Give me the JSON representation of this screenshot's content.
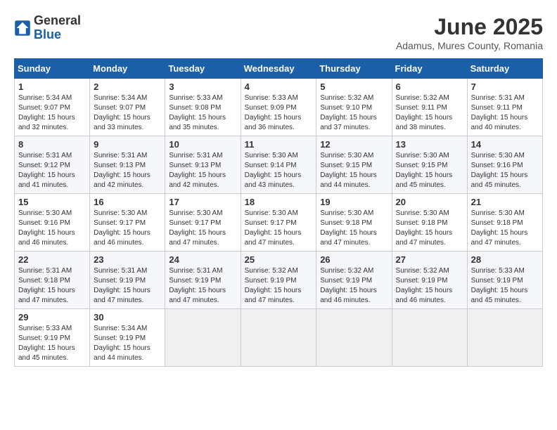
{
  "header": {
    "logo_general": "General",
    "logo_blue": "Blue",
    "title": "June 2025",
    "subtitle": "Adamus, Mures County, Romania"
  },
  "weekdays": [
    "Sunday",
    "Monday",
    "Tuesday",
    "Wednesday",
    "Thursday",
    "Friday",
    "Saturday"
  ],
  "weeks": [
    [
      {
        "day": "1",
        "sunrise": "Sunrise: 5:34 AM",
        "sunset": "Sunset: 9:07 PM",
        "daylight": "Daylight: 15 hours and 32 minutes."
      },
      {
        "day": "2",
        "sunrise": "Sunrise: 5:34 AM",
        "sunset": "Sunset: 9:07 PM",
        "daylight": "Daylight: 15 hours and 33 minutes."
      },
      {
        "day": "3",
        "sunrise": "Sunrise: 5:33 AM",
        "sunset": "Sunset: 9:08 PM",
        "daylight": "Daylight: 15 hours and 35 minutes."
      },
      {
        "day": "4",
        "sunrise": "Sunrise: 5:33 AM",
        "sunset": "Sunset: 9:09 PM",
        "daylight": "Daylight: 15 hours and 36 minutes."
      },
      {
        "day": "5",
        "sunrise": "Sunrise: 5:32 AM",
        "sunset": "Sunset: 9:10 PM",
        "daylight": "Daylight: 15 hours and 37 minutes."
      },
      {
        "day": "6",
        "sunrise": "Sunrise: 5:32 AM",
        "sunset": "Sunset: 9:11 PM",
        "daylight": "Daylight: 15 hours and 38 minutes."
      },
      {
        "day": "7",
        "sunrise": "Sunrise: 5:31 AM",
        "sunset": "Sunset: 9:11 PM",
        "daylight": "Daylight: 15 hours and 40 minutes."
      }
    ],
    [
      {
        "day": "8",
        "sunrise": "Sunrise: 5:31 AM",
        "sunset": "Sunset: 9:12 PM",
        "daylight": "Daylight: 15 hours and 41 minutes."
      },
      {
        "day": "9",
        "sunrise": "Sunrise: 5:31 AM",
        "sunset": "Sunset: 9:13 PM",
        "daylight": "Daylight: 15 hours and 42 minutes."
      },
      {
        "day": "10",
        "sunrise": "Sunrise: 5:31 AM",
        "sunset": "Sunset: 9:13 PM",
        "daylight": "Daylight: 15 hours and 42 minutes."
      },
      {
        "day": "11",
        "sunrise": "Sunrise: 5:30 AM",
        "sunset": "Sunset: 9:14 PM",
        "daylight": "Daylight: 15 hours and 43 minutes."
      },
      {
        "day": "12",
        "sunrise": "Sunrise: 5:30 AM",
        "sunset": "Sunset: 9:15 PM",
        "daylight": "Daylight: 15 hours and 44 minutes."
      },
      {
        "day": "13",
        "sunrise": "Sunrise: 5:30 AM",
        "sunset": "Sunset: 9:15 PM",
        "daylight": "Daylight: 15 hours and 45 minutes."
      },
      {
        "day": "14",
        "sunrise": "Sunrise: 5:30 AM",
        "sunset": "Sunset: 9:16 PM",
        "daylight": "Daylight: 15 hours and 45 minutes."
      }
    ],
    [
      {
        "day": "15",
        "sunrise": "Sunrise: 5:30 AM",
        "sunset": "Sunset: 9:16 PM",
        "daylight": "Daylight: 15 hours and 46 minutes."
      },
      {
        "day": "16",
        "sunrise": "Sunrise: 5:30 AM",
        "sunset": "Sunset: 9:17 PM",
        "daylight": "Daylight: 15 hours and 46 minutes."
      },
      {
        "day": "17",
        "sunrise": "Sunrise: 5:30 AM",
        "sunset": "Sunset: 9:17 PM",
        "daylight": "Daylight: 15 hours and 47 minutes."
      },
      {
        "day": "18",
        "sunrise": "Sunrise: 5:30 AM",
        "sunset": "Sunset: 9:17 PM",
        "daylight": "Daylight: 15 hours and 47 minutes."
      },
      {
        "day": "19",
        "sunrise": "Sunrise: 5:30 AM",
        "sunset": "Sunset: 9:18 PM",
        "daylight": "Daylight: 15 hours and 47 minutes."
      },
      {
        "day": "20",
        "sunrise": "Sunrise: 5:30 AM",
        "sunset": "Sunset: 9:18 PM",
        "daylight": "Daylight: 15 hours and 47 minutes."
      },
      {
        "day": "21",
        "sunrise": "Sunrise: 5:30 AM",
        "sunset": "Sunset: 9:18 PM",
        "daylight": "Daylight: 15 hours and 47 minutes."
      }
    ],
    [
      {
        "day": "22",
        "sunrise": "Sunrise: 5:31 AM",
        "sunset": "Sunset: 9:18 PM",
        "daylight": "Daylight: 15 hours and 47 minutes."
      },
      {
        "day": "23",
        "sunrise": "Sunrise: 5:31 AM",
        "sunset": "Sunset: 9:19 PM",
        "daylight": "Daylight: 15 hours and 47 minutes."
      },
      {
        "day": "24",
        "sunrise": "Sunrise: 5:31 AM",
        "sunset": "Sunset: 9:19 PM",
        "daylight": "Daylight: 15 hours and 47 minutes."
      },
      {
        "day": "25",
        "sunrise": "Sunrise: 5:32 AM",
        "sunset": "Sunset: 9:19 PM",
        "daylight": "Daylight: 15 hours and 47 minutes."
      },
      {
        "day": "26",
        "sunrise": "Sunrise: 5:32 AM",
        "sunset": "Sunset: 9:19 PM",
        "daylight": "Daylight: 15 hours and 46 minutes."
      },
      {
        "day": "27",
        "sunrise": "Sunrise: 5:32 AM",
        "sunset": "Sunset: 9:19 PM",
        "daylight": "Daylight: 15 hours and 46 minutes."
      },
      {
        "day": "28",
        "sunrise": "Sunrise: 5:33 AM",
        "sunset": "Sunset: 9:19 PM",
        "daylight": "Daylight: 15 hours and 45 minutes."
      }
    ],
    [
      {
        "day": "29",
        "sunrise": "Sunrise: 5:33 AM",
        "sunset": "Sunset: 9:19 PM",
        "daylight": "Daylight: 15 hours and 45 minutes."
      },
      {
        "day": "30",
        "sunrise": "Sunrise: 5:34 AM",
        "sunset": "Sunset: 9:19 PM",
        "daylight": "Daylight: 15 hours and 44 minutes."
      },
      null,
      null,
      null,
      null,
      null
    ]
  ]
}
